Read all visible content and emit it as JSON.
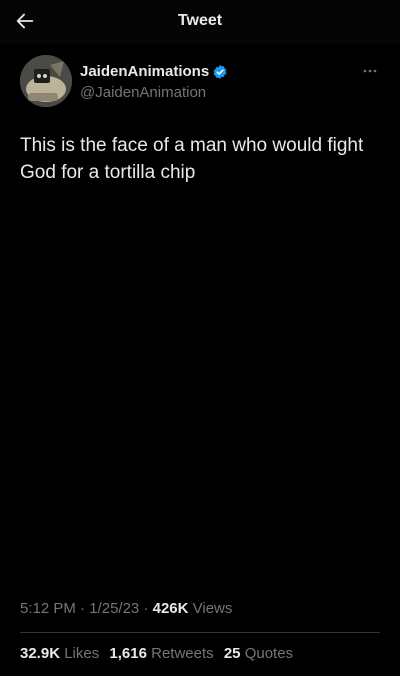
{
  "header": {
    "title": "Tweet",
    "back_icon": "arrow-left-icon"
  },
  "author": {
    "display_name": "JaidenAnimations",
    "handle": "@JaidenAnimation",
    "verified": true,
    "verified_color": "#1d9bf0"
  },
  "tweet": {
    "text": "This is the face of a man who would fight God for a tortilla chip"
  },
  "meta": {
    "time": "5:12 PM",
    "sep1": "·",
    "date": "1/25/23",
    "sep2": "·",
    "views_count": "426K",
    "views_label": "Views"
  },
  "stats": {
    "likes_count": "32.9K",
    "likes_label": "Likes",
    "retweets_count": "1,616",
    "retweets_label": "Retweets",
    "quotes_count": "25",
    "quotes_label": "Quotes"
  },
  "colors": {
    "background": "#000000",
    "text_primary": "#e7e9ea",
    "text_secondary": "#71767b",
    "divider": "#2f3336"
  }
}
